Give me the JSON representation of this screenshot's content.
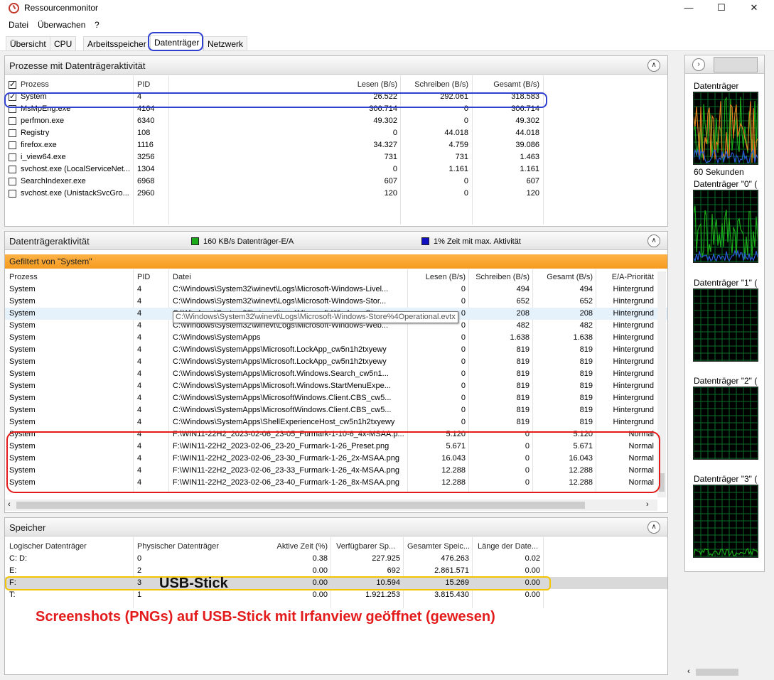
{
  "window": {
    "title": "Ressourcenmonitor"
  },
  "menu": [
    "Datei",
    "Überwachen",
    "?"
  ],
  "tabs": [
    "Übersicht",
    "CPU",
    "Arbeitsspeicher",
    "Datenträger",
    "Netzwerk"
  ],
  "processes_panel": {
    "title": "Prozesse mit Datenträgeraktivität",
    "columns": [
      "Prozess",
      "PID",
      "Lesen (B/s)",
      "Schreiben (B/s)",
      "Gesamt (B/s)"
    ],
    "rows": [
      [
        "System",
        "4",
        "26.522",
        "292.061",
        "318.583"
      ],
      [
        "MsMpEng.exe",
        "4164",
        "306.714",
        "0",
        "306.714"
      ],
      [
        "perfmon.exe",
        "6340",
        "49.302",
        "0",
        "49.302"
      ],
      [
        "Registry",
        "108",
        "0",
        "44.018",
        "44.018"
      ],
      [
        "firefox.exe",
        "1116",
        "34.327",
        "4.759",
        "39.086"
      ],
      [
        "i_view64.exe",
        "3256",
        "731",
        "731",
        "1.463"
      ],
      [
        "svchost.exe (LocalServiceNet...",
        "1304",
        "0",
        "1.161",
        "1.161"
      ],
      [
        "SearchIndexer.exe",
        "6968",
        "607",
        "0",
        "607"
      ],
      [
        "svchost.exe (UnistackSvcGro...",
        "2960",
        "120",
        "0",
        "120"
      ]
    ]
  },
  "disk_activity_panel": {
    "title": "Datenträgeraktivität",
    "legend_io": "160 KB/s Datenträger-E/A",
    "legend_io_color": "#1aaa1a",
    "legend_time": "1% Zeit mit max. Aktivität",
    "legend_time_color": "#1010c0",
    "filter": "Gefiltert von \"System\"",
    "columns": [
      "Prozess",
      "PID",
      "Datei",
      "Lesen (B/s)",
      "Schreiben (B/s)",
      "Gesamt (B/s)",
      "E/A-Priorität"
    ],
    "rows": [
      [
        "System",
        "4",
        "C:\\Windows\\System32\\winevt\\Logs\\Microsoft-Windows-Livel...",
        "0",
        "494",
        "494",
        "Hintergrund"
      ],
      [
        "System",
        "4",
        "C:\\Windows\\System32\\winevt\\Logs\\Microsoft-Windows-Stor...",
        "0",
        "652",
        "652",
        "Hintergrund"
      ],
      [
        "System",
        "4",
        "C:\\Windows\\System32\\winevt\\Logs\\Microsoft-Windows-Stor...",
        "0",
        "208",
        "208",
        "Hintergrund"
      ],
      [
        "System",
        "4",
        "C:\\Windows\\System32\\winevt\\Logs\\Microsoft-Windows-Web...",
        "0",
        "482",
        "482",
        "Hintergrund"
      ],
      [
        "System",
        "4",
        "C:\\Windows\\SystemApps",
        "0",
        "1.638",
        "1.638",
        "Hintergrund"
      ],
      [
        "System",
        "4",
        "C:\\Windows\\SystemApps\\Microsoft.LockApp_cw5n1h2txyewy",
        "0",
        "819",
        "819",
        "Hintergrund"
      ],
      [
        "System",
        "4",
        "C:\\Windows\\SystemApps\\Microsoft.LockApp_cw5n1h2txyewy",
        "0",
        "819",
        "819",
        "Hintergrund"
      ],
      [
        "System",
        "4",
        "C:\\Windows\\SystemApps\\Microsoft.Windows.Search_cw5n1...",
        "0",
        "819",
        "819",
        "Hintergrund"
      ],
      [
        "System",
        "4",
        "C:\\Windows\\SystemApps\\Microsoft.Windows.StartMenuExpe...",
        "0",
        "819",
        "819",
        "Hintergrund"
      ],
      [
        "System",
        "4",
        "C:\\Windows\\SystemApps\\MicrosoftWindows.Client.CBS_cw5...",
        "0",
        "819",
        "819",
        "Hintergrund"
      ],
      [
        "System",
        "4",
        "C:\\Windows\\SystemApps\\MicrosoftWindows.Client.CBS_cw5...",
        "0",
        "819",
        "819",
        "Hintergrund"
      ],
      [
        "System",
        "4",
        "C:\\Windows\\SystemApps\\ShellExperienceHost_cw5n1h2txyewy",
        "0",
        "819",
        "819",
        "Hintergrund"
      ],
      [
        "System",
        "4",
        "F:\\WIN11-22H2_2023-02-06_23-05_Furmark-1-10-6_4x-MSAA.p...",
        "5.120",
        "0",
        "5.120",
        "Normal"
      ],
      [
        "System",
        "4",
        "F:\\WIN11-22H2_2023-02-06_23-20_Furmark-1-26_Preset.png",
        "5.671",
        "0",
        "5.671",
        "Normal"
      ],
      [
        "System",
        "4",
        "F:\\WIN11-22H2_2023-02-06_23-30_Furmark-1-26_2x-MSAA.png",
        "16.043",
        "0",
        "16.043",
        "Normal"
      ],
      [
        "System",
        "4",
        "F:\\WIN11-22H2_2023-02-06_23-33_Furmark-1-26_4x-MSAA.png",
        "12.288",
        "0",
        "12.288",
        "Normal"
      ],
      [
        "System",
        "4",
        "F:\\WIN11-22H2_2023-02-06_23-40_Furmark-1-26_8x-MSAA.png",
        "12.288",
        "0",
        "12.288",
        "Normal"
      ]
    ],
    "tooltip": "C:\\Windows\\System32\\winevt\\Logs\\Microsoft-Windows-Store%4Operational.evtx"
  },
  "storage_panel": {
    "title": "Speicher",
    "columns": [
      "Logischer Datenträger",
      "Physischer Datenträger",
      "Aktive Zeit (%)",
      "Verfügbarer Sp...",
      "Gesamter Speic...",
      "Länge der Date..."
    ],
    "rows": [
      [
        "C: D:",
        "0",
        "0.38",
        "227.925",
        "476.263",
        "0.02"
      ],
      [
        "E:",
        "2",
        "0.00",
        "692",
        "2.861.571",
        "0.00"
      ],
      [
        "F:",
        "3",
        "0.00",
        "10.594",
        "15.269",
        "0.00"
      ],
      [
        "T:",
        "1",
        "0.00",
        "1.921.253",
        "3.815.430",
        "0.00"
      ]
    ]
  },
  "side_panel": {
    "labels": [
      "Datenträger",
      "60 Sekunden",
      "Datenträger \"0\" (",
      "Datenträger \"1\" (",
      "Datenträger \"2\" (",
      "Datenträger \"3\" ("
    ],
    "graph_line_colors": [
      "#1aaa1a",
      "#e08020",
      "#2a5bd7"
    ]
  },
  "annotations": {
    "usb_label": "USB-Stick",
    "note": "Screenshots (PNGs) auf USB-Stick mit Irfanview geöffnet (gewesen)"
  }
}
